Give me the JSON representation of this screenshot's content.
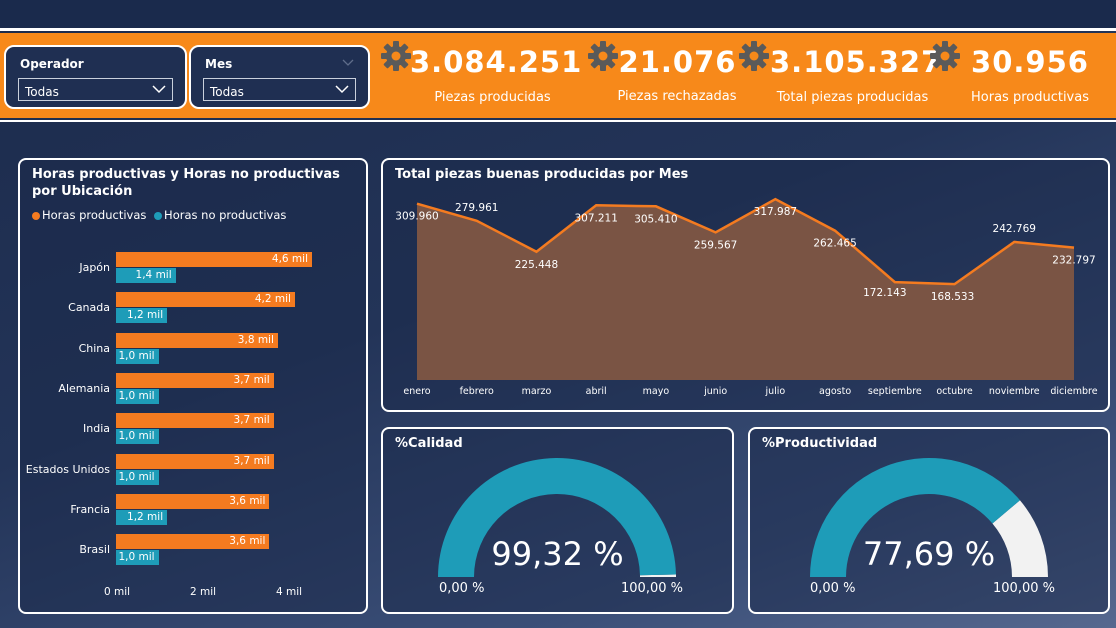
{
  "filters": {
    "operador": {
      "title": "Operador",
      "value": "Todas"
    },
    "mes": {
      "title": "Mes",
      "value": "Todas"
    }
  },
  "kpis": [
    {
      "value": "3.084.251",
      "label": "Piezas producidas",
      "icon": "gear-icon"
    },
    {
      "value": "21.076",
      "label": "Piezas rechazadas",
      "icon": "gear-icon"
    },
    {
      "value": "3.105.327",
      "label": "Total piezas producidas",
      "icon": "gear-icon"
    },
    {
      "value": "30.956",
      "label": "Horas productivas",
      "icon": "gear-icon"
    }
  ],
  "colors": {
    "orange": "#f7891a",
    "bar_orange": "#f47b20",
    "bar_blue": "#1e9cb8",
    "navy": "#1a2a4c",
    "gauge_blue": "#1e9cb8",
    "gauge_track": "#f2f2f2"
  },
  "hours_chart": {
    "title": "Horas productivas y Horas no productivas por Ubicación",
    "legend": [
      "Horas productivas",
      "Horas no productivas"
    ],
    "ticks": [
      "0 mil",
      "2 mil",
      "4 mil"
    ]
  },
  "months_chart": {
    "title": "Total piezas buenas producidas por Mes"
  },
  "calidad": {
    "title": "%Calidad",
    "value_label": "99,32 %",
    "min_label": "0,00 %",
    "max_label": "100,00 %",
    "value": 99.32
  },
  "productividad": {
    "title": "%Productividad",
    "value_label": "77,69 %",
    "min_label": "0,00 %",
    "max_label": "100,00 %",
    "value": 77.69
  },
  "chart_data": [
    {
      "type": "bar",
      "title": "Horas productivas y Horas no productivas por Ubicación",
      "categories": [
        "Japón",
        "Canada",
        "China",
        "Alemania",
        "India",
        "Estados Unidos",
        "Francia",
        "Brasil"
      ],
      "series": [
        {
          "name": "Horas productivas",
          "values": [
            4.6,
            4.2,
            3.8,
            3.7,
            3.7,
            3.7,
            3.6,
            3.6
          ],
          "labels": [
            "4,6 mil",
            "4,2 mil",
            "3,8 mil",
            "3,7 mil",
            "3,7 mil",
            "3,7 mil",
            "3,6 mil",
            "3,6 mil"
          ]
        },
        {
          "name": "Horas no productivas",
          "values": [
            1.4,
            1.2,
            1.0,
            1.0,
            1.0,
            1.0,
            1.2,
            1.0
          ],
          "labels": [
            "1,4 mil",
            "1,2 mil",
            "1,0 mil",
            "1,0 mil",
            "1,0 mil",
            "1,0 mil",
            "1,2 mil",
            "1,0 mil"
          ]
        }
      ],
      "xlim": [
        0,
        4.6
      ],
      "x_ticks": [
        "0 mil",
        "2 mil",
        "4 mil"
      ],
      "legend": "top-left"
    },
    {
      "type": "area",
      "title": "Total piezas buenas producidas por Mes",
      "categories": [
        "enero",
        "febrero",
        "marzo",
        "abril",
        "mayo",
        "junio",
        "julio",
        "agosto",
        "septiembre",
        "octubre",
        "noviembre",
        "diciembre"
      ],
      "values": [
        309960,
        279961,
        225448,
        307211,
        305410,
        259567,
        317987,
        262465,
        172143,
        168533,
        242769,
        232797
      ],
      "labels": [
        "309.960",
        "279.961",
        "225.448",
        "307.211",
        "305.410",
        "259.567",
        "317.987",
        "262.465",
        "172.143",
        "168.533",
        "242.769",
        "232.797"
      ],
      "ylim": [
        0,
        320000
      ]
    }
  ]
}
